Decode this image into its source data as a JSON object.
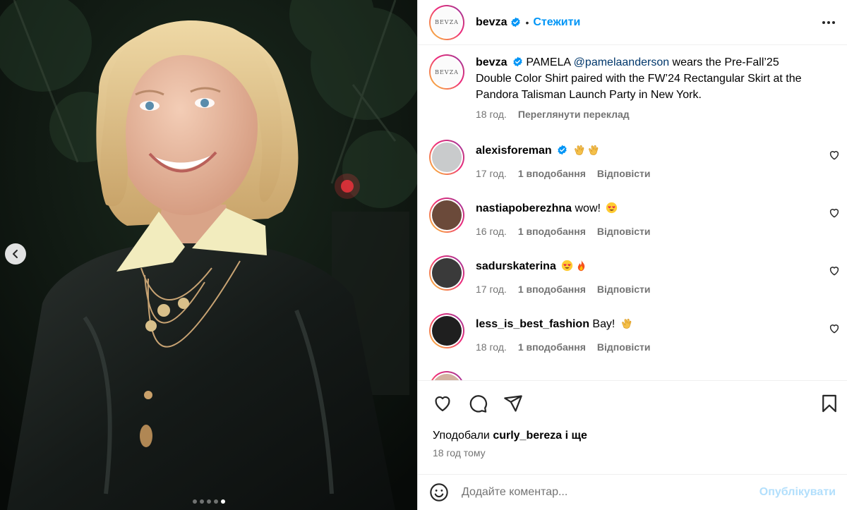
{
  "post": {
    "author": "bevza",
    "follow_label": "Стежити",
    "brand_logo_text": "BEVZA",
    "caption": {
      "username": "bevza",
      "prefix": "PAMELA ",
      "mention": "@pamelaanderson",
      "text": " wears the Pre-Fall’25 Double Color Shirt paired with the FW’24 Rectangular Skirt at the Pandora Talisman Launch Party in New York.",
      "time": "18 год.",
      "translate_label": "Переглянути переклад"
    },
    "carousel": {
      "slide_count": 5,
      "active_index": 4
    }
  },
  "comments": [
    {
      "username": "alexisforeman",
      "verified": true,
      "text": "",
      "emojis": [
        "clap-emoji",
        "clap-emoji"
      ],
      "time": "17 год.",
      "likes": "1 вподобання",
      "reply": "Відповісти"
    },
    {
      "username": "nastiapoberezhna",
      "verified": false,
      "text": "wow!",
      "emojis": [
        "heart-eyes-emoji"
      ],
      "time": "16 год.",
      "likes": "1 вподобання",
      "reply": "Відповісти"
    },
    {
      "username": "sadurskaterina",
      "verified": false,
      "text": "",
      "emojis": [
        "heart-eyes-emoji",
        "fire-emoji"
      ],
      "time": "17 год.",
      "likes": "1 вподобання",
      "reply": "Відповісти"
    },
    {
      "username": "less_is_best_fashion",
      "verified": false,
      "text": "Вау!",
      "emojis": [
        "clap-emoji"
      ],
      "time": "18 год.",
      "likes": "1 вподобання",
      "reply": "Відповісти"
    }
  ],
  "footer": {
    "likes_prefix": "Уподобали ",
    "likes_user": "curly_bereza",
    "likes_suffix": " і ще",
    "time_ago": "18 год тому",
    "comment_placeholder": "Додайте коментар...",
    "publish_label": "Опублікувати"
  },
  "colors": {
    "accent": "#0095f6",
    "publish_disabled": "#b2dffc",
    "secondary_text": "#737373",
    "mention": "#00376b"
  }
}
